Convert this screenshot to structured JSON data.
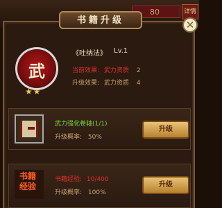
{
  "window": {
    "title": "书籍升级",
    "background_value": "80",
    "detail_tab": "详情"
  },
  "book": {
    "name": "《吐纳法》",
    "level": "Lv.1",
    "icon_char": "武",
    "stars": "★★",
    "current_effect_label": "当前效果:",
    "current_effect_attr": "武力资质",
    "current_effect_value": "2",
    "upgrade_effect_label": "升级效果:",
    "upgrade_effect_attr": "武力资质",
    "upgrade_effect_value": "4"
  },
  "scroll_option": {
    "item_name": "武力强化卷轴(1/1)",
    "rate_label": "升级概率:",
    "rate_value": "50%",
    "button_label": "升级"
  },
  "exp_option": {
    "icon_text_1": "书籍",
    "icon_text_2": "经验",
    "exp_label": "书籍经验:",
    "exp_value": "10/400",
    "rate_label": "升级概率:",
    "rate_value": "100%",
    "button_label": "升级"
  },
  "colors": {
    "accent_red": "#e0302a",
    "tan": "#c9a26a",
    "green": "#7ad23a",
    "button_gold": "#d9a54a"
  }
}
